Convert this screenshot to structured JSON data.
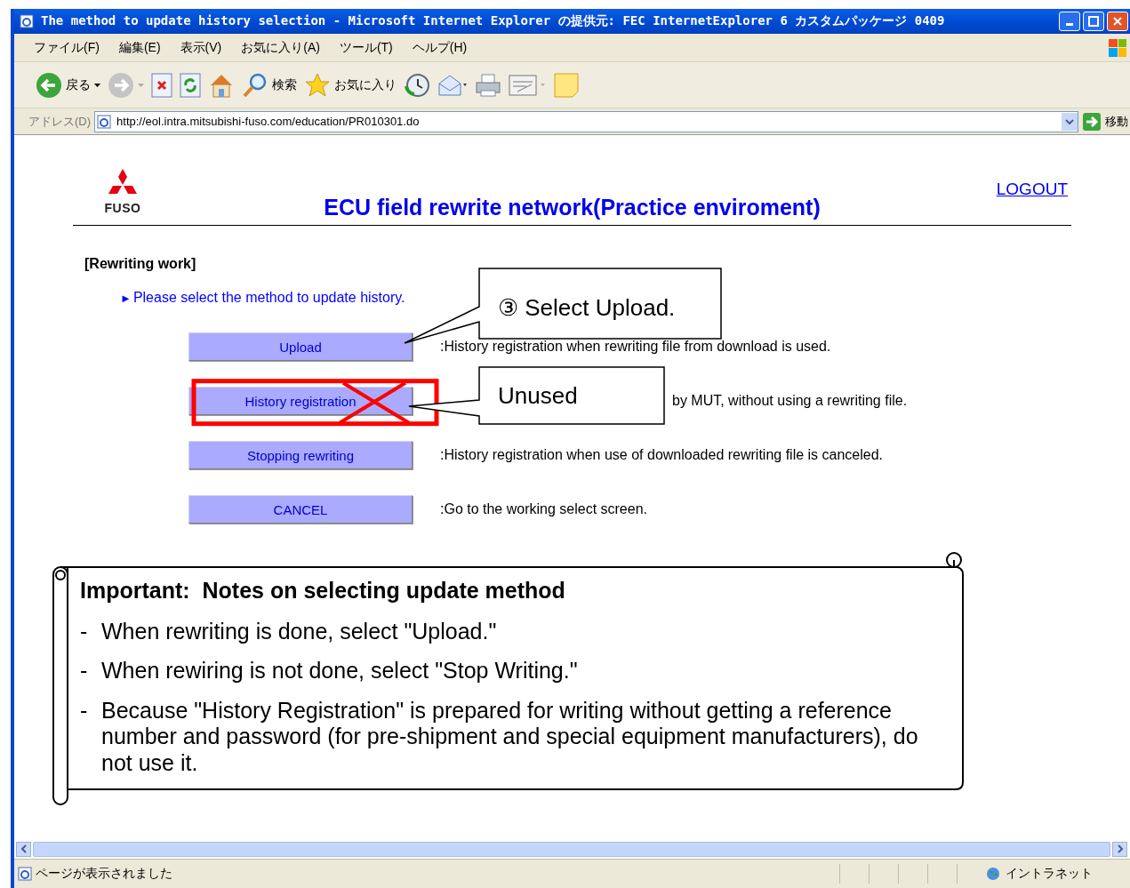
{
  "window": {
    "title": "The method to update history selection - Microsoft Internet Explorer の提供元: FEC InternetExplorer 6 カスタムパッケージ 0409"
  },
  "menu": [
    {
      "label": "ファイル(F)"
    },
    {
      "label": "編集(E)"
    },
    {
      "label": "表示(V)"
    },
    {
      "label": "お気に入り(A)"
    },
    {
      "label": "ツール(T)"
    },
    {
      "label": "ヘルプ(H)"
    }
  ],
  "toolbar": [
    {
      "kind": "back",
      "label": "戻る"
    },
    {
      "kind": "forward"
    },
    {
      "kind": "stop"
    },
    {
      "kind": "refresh"
    },
    {
      "kind": "home"
    },
    {
      "kind": "search",
      "label": "検索"
    },
    {
      "kind": "favorites",
      "label": "お気に入り"
    },
    {
      "kind": "history"
    },
    {
      "kind": "mail"
    },
    {
      "kind": "print"
    },
    {
      "kind": "edit"
    },
    {
      "kind": "note"
    }
  ],
  "address": {
    "label": "アドレス(D)",
    "url": "http://eol.intra.mitsubishi-fuso.com/education/PR010301.do",
    "go": "移動"
  },
  "page": {
    "logo": "FUSO",
    "heading": "ECU field rewrite network(Practice enviroment)",
    "logout": "LOGOUT",
    "section": "[Rewriting work]",
    "marker": "►",
    "instruction": "Please select the method to update history.",
    "options": [
      {
        "button": "Upload",
        "description": ":History registration when rewriting file from download is used.",
        "crossed_out": false
      },
      {
        "button": "History registration",
        "description": "by MUT, without using a rewriting file.",
        "crossed_out": true
      },
      {
        "button": "Stopping rewriting",
        "description": ":History registration when use of downloaded rewriting file is canceled.",
        "crossed_out": false
      },
      {
        "button": "CANCEL",
        "description": ":Go to the working select screen.",
        "crossed_out": false
      }
    ]
  },
  "callouts": [
    {
      "text": "③ Select Upload."
    },
    {
      "text": "Unused"
    }
  ],
  "note": {
    "title": "Important:  Notes on selecting update method",
    "items": [
      {
        "bullet": "-",
        "text": "When rewriting is done, select \"Upload.\""
      },
      {
        "bullet": "-",
        "text": "When rewiring is not done, select \"Stop Writing.\""
      },
      {
        "bullet": "-",
        "text": "Because \"History Registration\" is prepared for writing without getting a reference number and password (for pre-shipment and special equipment manufacturers), do not use it."
      }
    ]
  },
  "status_bar": {
    "text": "ページが表示されました",
    "zone": "イントラネット"
  }
}
